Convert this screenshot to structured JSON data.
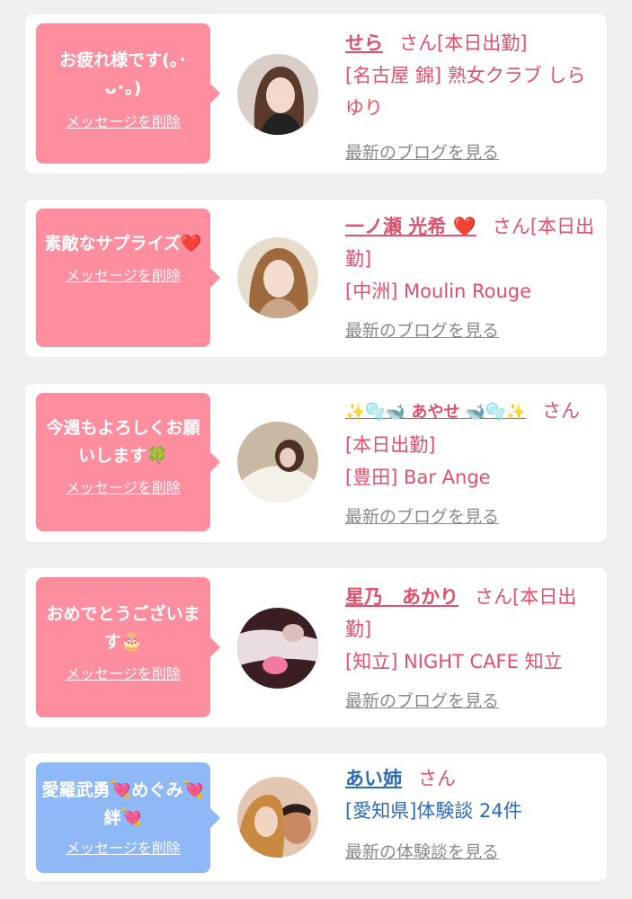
{
  "items": [
    {
      "message": "お疲れ様です(｡･ᴗ･｡)",
      "delete_label": "メッセージを削除",
      "name": "せら",
      "san": "さん[本日出勤]",
      "shop": "[名古屋 錦] 熟女クラブ しらゆり",
      "blog_link": "最新のブログを見る"
    },
    {
      "message": "素敵なサプライズ❤️",
      "delete_label": "メッセージを削除",
      "name": "一ノ瀬 光希 ❤️",
      "san": "さん[本日出勤]",
      "shop": "[中洲] Moulin Rouge",
      "blog_link": "最新のブログを見る"
    },
    {
      "message": "今週もよろしくお願いします🍀",
      "delete_label": "メッセージを削除",
      "name": "✨🫧🐋 あやせ 🐋🫧✨",
      "san": "さん[本日出勤]",
      "shop": "[豊田] Bar Ange",
      "blog_link": "最新のブログを見る"
    },
    {
      "message": "おめでとうございます🎂",
      "delete_label": "メッセージを削除",
      "name": "星乃　あかり",
      "san": "さん[本日出勤]",
      "shop": "[知立] NIGHT CAFE 知立",
      "blog_link": "最新のブログを見る"
    },
    {
      "message": "愛羅武勇💘めぐみ💘絆💘",
      "delete_label": "メッセージを削除",
      "name": "あい姉",
      "san": "さん",
      "shop": "[愛知県]体験談 24件",
      "blog_link": "最新の体験談を見る"
    }
  ],
  "colors": {
    "bubble_pink": "#fc8ea0",
    "bubble_blue": "#8eb8f6",
    "accent_pink": "#e0506d",
    "accent_blue": "#2e6ab5",
    "link_gray": "#8a8a8a",
    "background": "#efefef"
  }
}
